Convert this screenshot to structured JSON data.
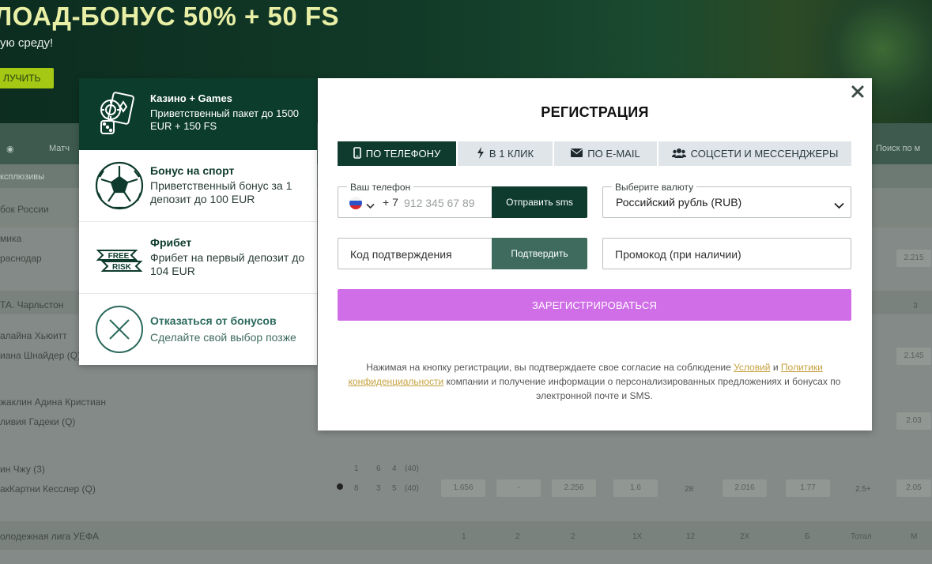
{
  "background": {
    "banner_title": "ЛОАД-БОНУС 50% + 50 FS",
    "banner_sub": "ую среду!",
    "banner_button": "ЛУЧИТЬ",
    "nav_tab": "Матч",
    "nav_right": "Поиск по м",
    "sub_nav_left": "ксплюзивы",
    "rows": [
      {
        "text": "бок России"
      },
      {
        "text": "мика"
      },
      {
        "text": "раснодар"
      },
      {
        "text": "ТА. Чарльстон"
      },
      {
        "text": "алайна Хьюитт"
      },
      {
        "text": "иана Шнайдер (Q)"
      },
      {
        "text": "жаклин Адина Кристиан"
      },
      {
        "text": "ливия Гадеки (Q)"
      },
      {
        "text": "ин Чжу (3)"
      },
      {
        "text": "акКартни Кесслер (Q)"
      },
      {
        "text": "олодежная лига УЕФА"
      }
    ],
    "odds": [
      "2.215",
      "3",
      "2.145",
      "2.03",
      "1.656",
      "-",
      "2.256",
      "1.6",
      "28",
      "2.016",
      "1.77",
      "2.5+",
      "2.05",
      "Тотал",
      "М"
    ],
    "score_row_1": [
      "1",
      "6",
      "4",
      "(40)"
    ],
    "score_row_2": [
      "8",
      "3",
      "5",
      "(40)"
    ],
    "bottom_row_numbers": [
      "1",
      "2",
      "2",
      "1X",
      "12",
      "2X",
      "Б",
      "Тотал",
      "М"
    ]
  },
  "bonus_panel": {
    "items": [
      {
        "title": "Казино + Games",
        "desc": "Приветственный пакет до 1500 EUR + 150 FS",
        "icon": "casino-chips-icon"
      },
      {
        "title": "Бонус на спорт",
        "desc": "Приветственный бонус за 1 депозит до 100 EUR",
        "icon": "soccer-ball-icon"
      },
      {
        "title": "Фрибет",
        "desc": "Фрибет на первый депозит до 104 EUR",
        "icon": "free-risk-icon",
        "icon_text_top": "FREE",
        "icon_text_bottom": "RISK"
      },
      {
        "title": "Отказаться от бонусов",
        "desc": "Сделайте свой выбор позже",
        "icon": "decline-x-icon"
      }
    ]
  },
  "modal": {
    "title": "РЕГИСТРАЦИЯ",
    "tabs": [
      {
        "label": "ПО ТЕЛЕФОНУ",
        "icon": "phone-icon"
      },
      {
        "label": "В 1 КЛИК",
        "icon": "lightning-icon"
      },
      {
        "label": "ПО E-MAIL",
        "icon": "envelope-icon"
      },
      {
        "label": "СОЦСЕТИ И МЕССЕНДЖЕРЫ",
        "icon": "users-icon"
      }
    ],
    "phone": {
      "label": "Ваш телефон",
      "code": "+ 7",
      "placeholder": "912 345 67 89",
      "sms_button": "Отправить sms"
    },
    "currency": {
      "label": "Выберите валюту",
      "value": "Российский рубль (RUB)"
    },
    "code": {
      "placeholder": "Код подтверждения",
      "confirm_button": "Подтвердить"
    },
    "promo": {
      "placeholder": "Промокод (при наличии)"
    },
    "register_button": "ЗАРЕГИСТРИРОВАТЬСЯ",
    "legal": {
      "part1": "Нажимая на кнопку регистрации, вы подтверждаете свое согласие на соблюдение",
      "link_terms": "Условий",
      "part2": "и",
      "link_privacy": "Политики конфиденциальности",
      "part3": "компании и получение информации о персонализированных предложениях и бонусах по электронной почте и SMS."
    }
  },
  "colors": {
    "primary_dark_green": "#0e3b2d",
    "confirm_green": "#3e6b5e",
    "register_purple": "#d06ee8",
    "link_gold": "#c5a13e",
    "tab_inactive": "#dfe5e8"
  }
}
